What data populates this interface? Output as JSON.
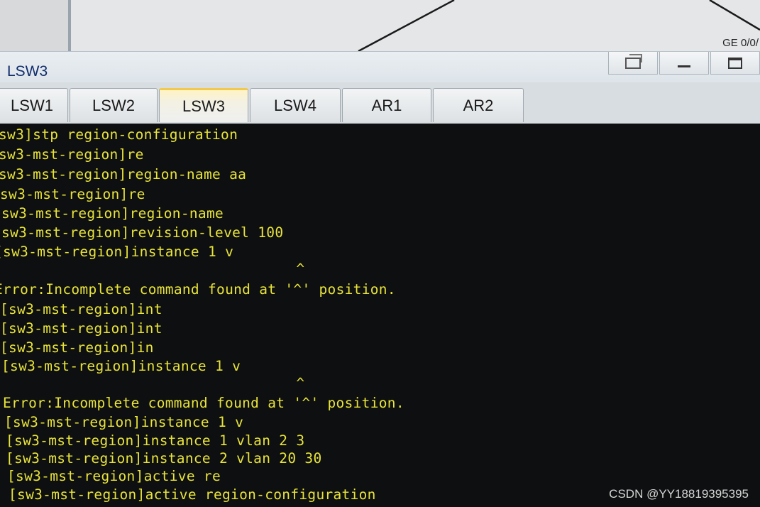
{
  "background": {
    "port_label": "GE 0/0/"
  },
  "window": {
    "title": "LSW3"
  },
  "tabs": [
    {
      "label": "LSW1",
      "active": false
    },
    {
      "label": "LSW2",
      "active": false
    },
    {
      "label": "LSW3",
      "active": true
    },
    {
      "label": "LSW4",
      "active": false
    },
    {
      "label": "AR1",
      "active": false
    },
    {
      "label": "AR2",
      "active": false
    }
  ],
  "terminal": {
    "lines": [
      "sw3]stp region-configuration",
      "sw3-mst-region]re",
      "sw3-mst-region]region-name aa",
      "sw3-mst-region]re",
      "sw3-mst-region]region-name",
      "[sw3-mst-region]revision-level 100",
      "[sw3-mst-region]instance 1 v",
      "                                   ^",
      "Error:Incomplete command found at '^' position.",
      "[sw3-mst-region]int",
      "[sw3-mst-region]int",
      "[sw3-mst-region]in",
      "[sw3-mst-region]instance 1 v",
      "                                  ^",
      "Error:Incomplete command found at '^' position.",
      "[sw3-mst-region]instance 1 v",
      "[sw3-mst-region]instance 1 vlan 2 3",
      "[sw3-mst-region]instance 2 vlan 20 30",
      "[sw3-mst-region]active re",
      "[sw3-mst-region]active region-configuration"
    ],
    "text_color": "#e8e43a",
    "background_color": "#0e0f10"
  },
  "watermark": "CSDN @YY18819395395"
}
